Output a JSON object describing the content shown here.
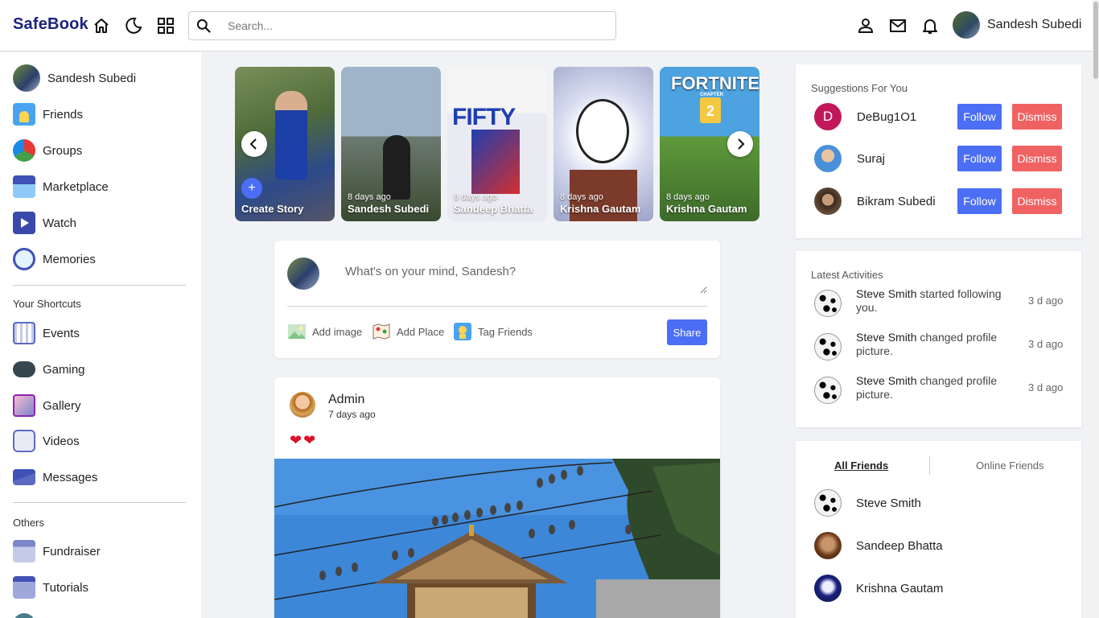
{
  "app": {
    "logo": "SafeBook"
  },
  "header": {
    "search_placeholder": "Search...",
    "user_name": "Sandesh Subedi"
  },
  "sidebar": {
    "profile_name": "Sandesh Subedi",
    "main_items": [
      {
        "label": "Friends",
        "icon": "friends-icon"
      },
      {
        "label": "Groups",
        "icon": "groups-icon"
      },
      {
        "label": "Marketplace",
        "icon": "marketplace-icon"
      },
      {
        "label": "Watch",
        "icon": "watch-icon"
      },
      {
        "label": "Memories",
        "icon": "memories-icon"
      }
    ],
    "shortcuts_heading": "Your Shortcuts",
    "shortcuts": [
      {
        "label": "Events",
        "icon": "events-icon"
      },
      {
        "label": "Gaming",
        "icon": "gaming-icon"
      },
      {
        "label": "Gallery",
        "icon": "gallery-icon"
      },
      {
        "label": "Videos",
        "icon": "videos-icon"
      },
      {
        "label": "Messages",
        "icon": "messages-icon"
      }
    ],
    "others_heading": "Others",
    "others": [
      {
        "label": "Fundraiser",
        "icon": "fundraiser-icon"
      },
      {
        "label": "Tutorials",
        "icon": "tutorials-icon"
      }
    ]
  },
  "stories": {
    "create_label": "Create Story",
    "plus": "+",
    "items": [
      {
        "time": "8 days ago",
        "name": "Sandesh Subedi"
      },
      {
        "time": "8 days ago",
        "name": "Sandeep Bhatta"
      },
      {
        "time": "8 days ago",
        "name": "Krishna Gautam"
      },
      {
        "time": "8 days ago",
        "name": "Krishna Gautam"
      }
    ],
    "story_texts": {
      "fifty": "FIFTY",
      "fortnite": "FORTNITE",
      "chapter": "CHAPTER",
      "chapter_num": "2"
    }
  },
  "composer": {
    "placeholder": "What's on your mind, Sandesh?",
    "actions": [
      {
        "label": "Add image",
        "icon": "image-icon"
      },
      {
        "label": "Add Place",
        "icon": "map-icon"
      },
      {
        "label": "Tag Friends",
        "icon": "tag-friends-icon"
      }
    ],
    "share_label": "Share"
  },
  "post": {
    "author": "Admin",
    "time": "7 days ago",
    "reactions": "❤❤"
  },
  "suggestions": {
    "title": "Suggestions For You",
    "follow_label": "Follow",
    "dismiss_label": "Dismiss",
    "items": [
      {
        "name": "DeBug1O1",
        "initial": "D"
      },
      {
        "name": "Suraj"
      },
      {
        "name": "Bikram Subedi"
      }
    ]
  },
  "activities": {
    "title": "Latest Activities",
    "items": [
      {
        "actor": "Steve Smith",
        "action": " started following you.",
        "when": "3 d ago"
      },
      {
        "actor": "Steve Smith",
        "action": " changed profile picture.",
        "when": "3 d ago"
      },
      {
        "actor": "Steve Smith",
        "action": " changed profile picture.",
        "when": "3 d ago"
      }
    ]
  },
  "friends": {
    "tabs": [
      "All Friends",
      "Online Friends"
    ],
    "items": [
      {
        "name": "Steve Smith"
      },
      {
        "name": "Sandeep Bhatta"
      },
      {
        "name": "Krishna Gautam"
      }
    ]
  },
  "colors": {
    "brand": "#1a237e",
    "primary_button": "#4c6ef5",
    "danger_button": "#f06262",
    "heart": "#e0102a"
  }
}
